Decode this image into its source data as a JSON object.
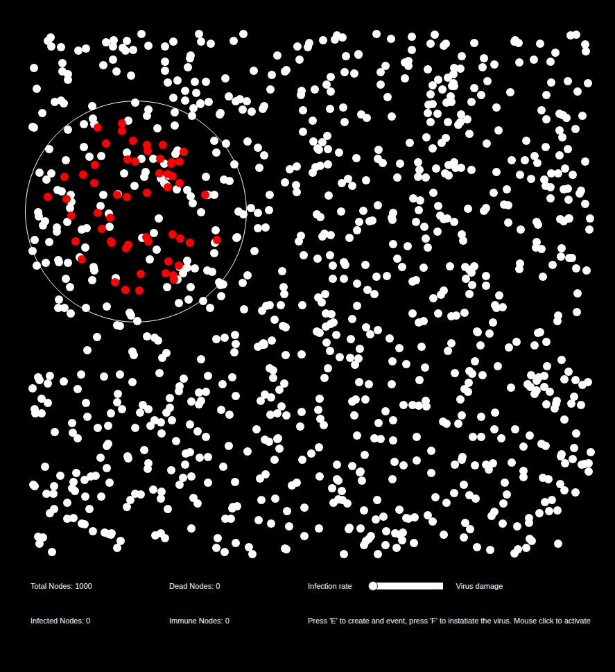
{
  "canvas": {
    "nodes": [
      {
        "state": "healthy",
        "count": 945,
        "color": "#ffffff"
      },
      {
        "state": "infected",
        "count": 55,
        "color": "#ff0000"
      }
    ],
    "event": {
      "active": true
    }
  },
  "stats": [
    {
      "label": "Total Nodes: 1000"
    },
    {
      "label": "Dead Nodes: 0"
    },
    {
      "label": "Infected Nodes: 0"
    },
    {
      "label": "Immune Nodes: 0"
    }
  ],
  "controls": {
    "infection_rate": {
      "label": "Infection rate",
      "level": 0
    },
    "virus_damage": {
      "label": "Virus damage"
    }
  },
  "help": "Press 'E' to create and event, press 'F' to instatiate the virus. Mouse click to activate"
}
